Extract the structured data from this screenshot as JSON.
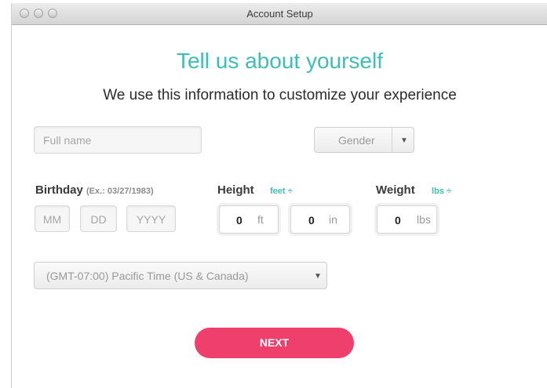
{
  "window": {
    "title": "Account Setup"
  },
  "header": {
    "title": "Tell us about yourself",
    "subtitle": "We use this information to customize your experience"
  },
  "form": {
    "full_name": {
      "placeholder": "Full name",
      "value": ""
    },
    "gender": {
      "selected": "Gender"
    },
    "birthday": {
      "label": "Birthday",
      "hint": "(Ex.: 03/27/1983)",
      "month_placeholder": "MM",
      "day_placeholder": "DD",
      "year_placeholder": "YYYY"
    },
    "height": {
      "label": "Height",
      "unit_selector": "feet ÷",
      "feet_value": "0",
      "feet_unit": "ft",
      "inches_value": "0",
      "inches_unit": "in"
    },
    "weight": {
      "label": "Weight",
      "unit_selector": "lbs ÷",
      "value": "0",
      "unit": "lbs"
    },
    "timezone": {
      "selected": "(GMT-07:00) Pacific Time (US & Canada)"
    },
    "next_label": "NEXT"
  },
  "colors": {
    "accent": "#3fbfb4",
    "button": "#ee3f6d"
  }
}
